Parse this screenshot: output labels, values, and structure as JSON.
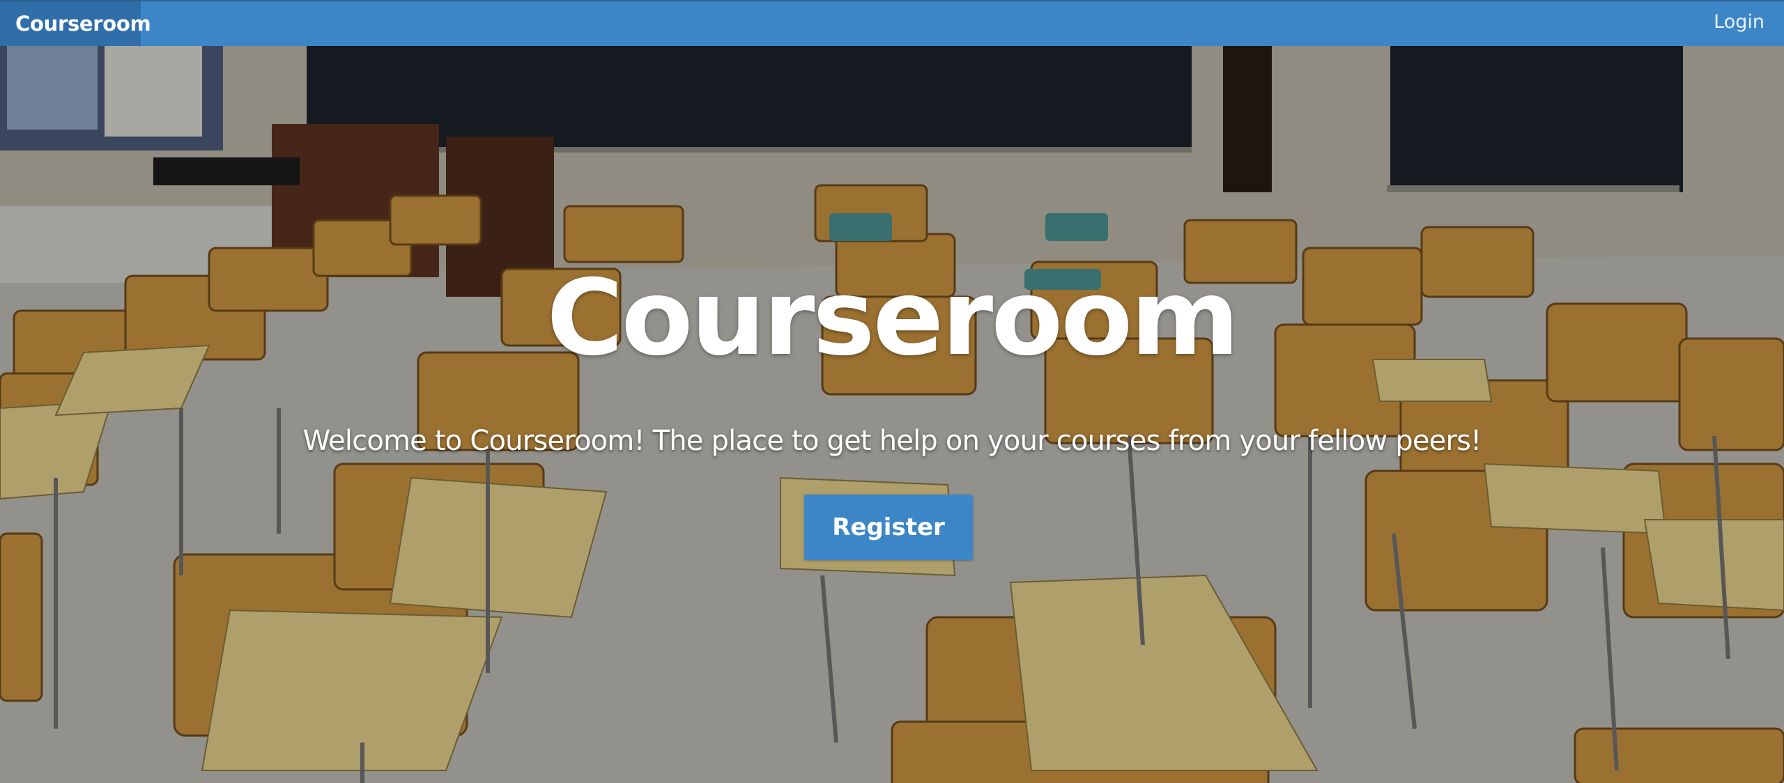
{
  "navbar": {
    "brand": "Courseroom",
    "login_label": "Login",
    "background_color": "#3c86c8",
    "brand_background_color": "#2f6ea8"
  },
  "hero": {
    "title": "Courseroom",
    "subtitle": "Welcome to Courseroom! The place to get help on your courses from your fellow peers!",
    "register_label": "Register",
    "button_color": "#3c86c8"
  }
}
